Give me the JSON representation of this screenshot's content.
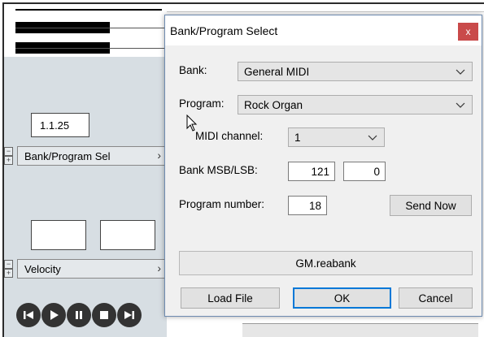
{
  "editor": {
    "position_value": "1.1.25",
    "lanes": [
      {
        "label": "Bank/Program Sel"
      },
      {
        "label": "Velocity"
      }
    ],
    "transport_icons": [
      "skip-back-icon",
      "play-icon",
      "pause-icon",
      "stop-icon",
      "skip-forward-icon"
    ]
  },
  "dialog": {
    "title": "Bank/Program Select",
    "close_symbol": "x",
    "bank": {
      "label": "Bank:",
      "value": "General MIDI"
    },
    "program": {
      "label": "Program:",
      "value": "Rock Organ"
    },
    "midi_channel": {
      "label": "MIDI channel:",
      "value": "1"
    },
    "bank_msb_lsb": {
      "label": "Bank MSB/LSB:",
      "msb": "121",
      "lsb": "0"
    },
    "program_number": {
      "label": "Program number:",
      "value": "18"
    },
    "send_now_label": "Send Now",
    "file_status": "GM.reabank",
    "load_file_label": "Load File",
    "ok_label": "OK",
    "cancel_label": "Cancel",
    "colors": {
      "close_button": "#c94a4a",
      "default_button_border": "#0078d7",
      "window_border": "#6e8bb0"
    }
  }
}
